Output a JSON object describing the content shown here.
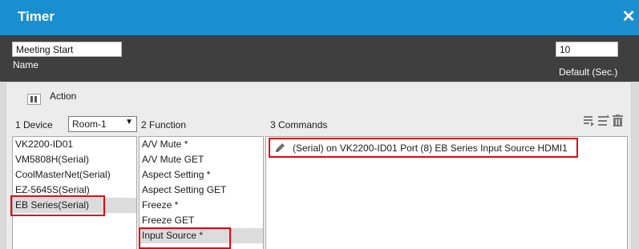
{
  "window": {
    "title": "Timer"
  },
  "timer": {
    "name_value": "Meeting Start",
    "name_label": "Name",
    "default_value": "10",
    "default_label": "Default (Sec.)"
  },
  "action": {
    "label": "Action"
  },
  "columns": {
    "device_header": "1  Device",
    "room_selected": "Room-1",
    "function_header": "2  Function",
    "commands_header": "3  Commands"
  },
  "devices": [
    "VK2200-ID01",
    "VM5808H(Serial)",
    "CoolMasterNet(Serial)",
    "EZ-5645S(Serial)",
    "EB Series(Serial)"
  ],
  "selected_device": "EB Series(Serial)",
  "functions": [
    "A/V Mute *",
    "A/V Mute GET",
    "Aspect Setting *",
    "Aspect Setting GET",
    "Freeze *",
    "Freeze GET",
    "Input Source *"
  ],
  "selected_function": "Input Source *",
  "commands": [
    "(Serial) on VK2200-ID01 Port (8) EB Series Input Source  HDMI1"
  ],
  "icons": {
    "close": "close-icon",
    "action_toggle": "panel-toggle-icon",
    "edit": "pencil-icon",
    "add": "add-command-icon",
    "move": "move-command-icon",
    "delete": "trash-icon"
  },
  "colors": {
    "title_bar": "#1a8fd0",
    "header_band": "#3f3f3f",
    "highlight": "#e30613",
    "selection": "#dcdcdc"
  }
}
